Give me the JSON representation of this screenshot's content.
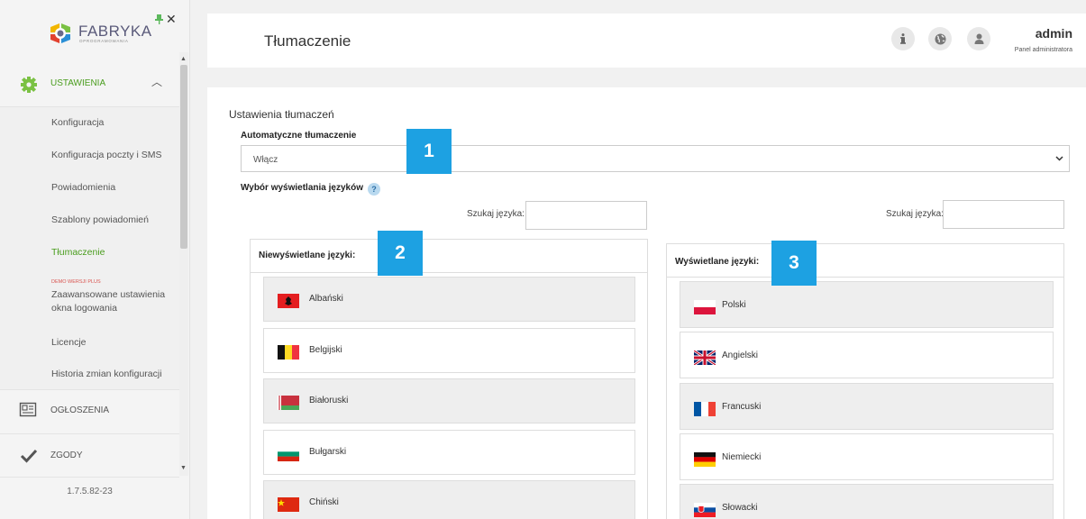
{
  "logo": {
    "word": "FABRYKA",
    "sub": "OPROGRAMOWANIA"
  },
  "sidebar": {
    "section_settings": "USTAWIENIA",
    "items": [
      {
        "label": "Konfiguracja"
      },
      {
        "label": "Konfiguracja poczty i SMS"
      },
      {
        "label": "Powiadomienia"
      },
      {
        "label": "Szablony powiadomień"
      },
      {
        "label": "Tłumaczenie"
      }
    ],
    "demo_tag": "DEMO WERSJI PLUS",
    "demo_label": "Zaawansowane ustawienia okna logowania",
    "items_after": [
      {
        "label": "Licencje"
      },
      {
        "label": "Historia zmian konfiguracji"
      }
    ],
    "section_ads": "OGŁOSZENIA",
    "section_consents": "ZGODY",
    "version": "1.7.5.82-23"
  },
  "header": {
    "title": "Tłumaczenie",
    "user_name": "admin",
    "user_role": "Panel administratora"
  },
  "content": {
    "section_title": "Ustawienia tłumaczeń",
    "auto_label": "Automatyczne tłumaczenie",
    "auto_value": "Włącz",
    "lang_choice_label": "Wybór wyświetlania języków",
    "help": "?",
    "search_label": "Szukaj języka:",
    "hidden_title": "Niewyświetlane języki:",
    "shown_title": "Wyświetlane języki:",
    "hidden_langs": [
      "Albański",
      "Belgijski",
      "Białoruski",
      "Bułgarski",
      "Chiński"
    ],
    "shown_langs": [
      "Polski",
      "Angielski",
      "Francuski",
      "Niemiecki",
      "Słowacki"
    ]
  },
  "badges": [
    "1",
    "2",
    "3"
  ],
  "colors": {
    "accent_green": "#4a9d1e",
    "badge_blue": "#1da1e2"
  }
}
